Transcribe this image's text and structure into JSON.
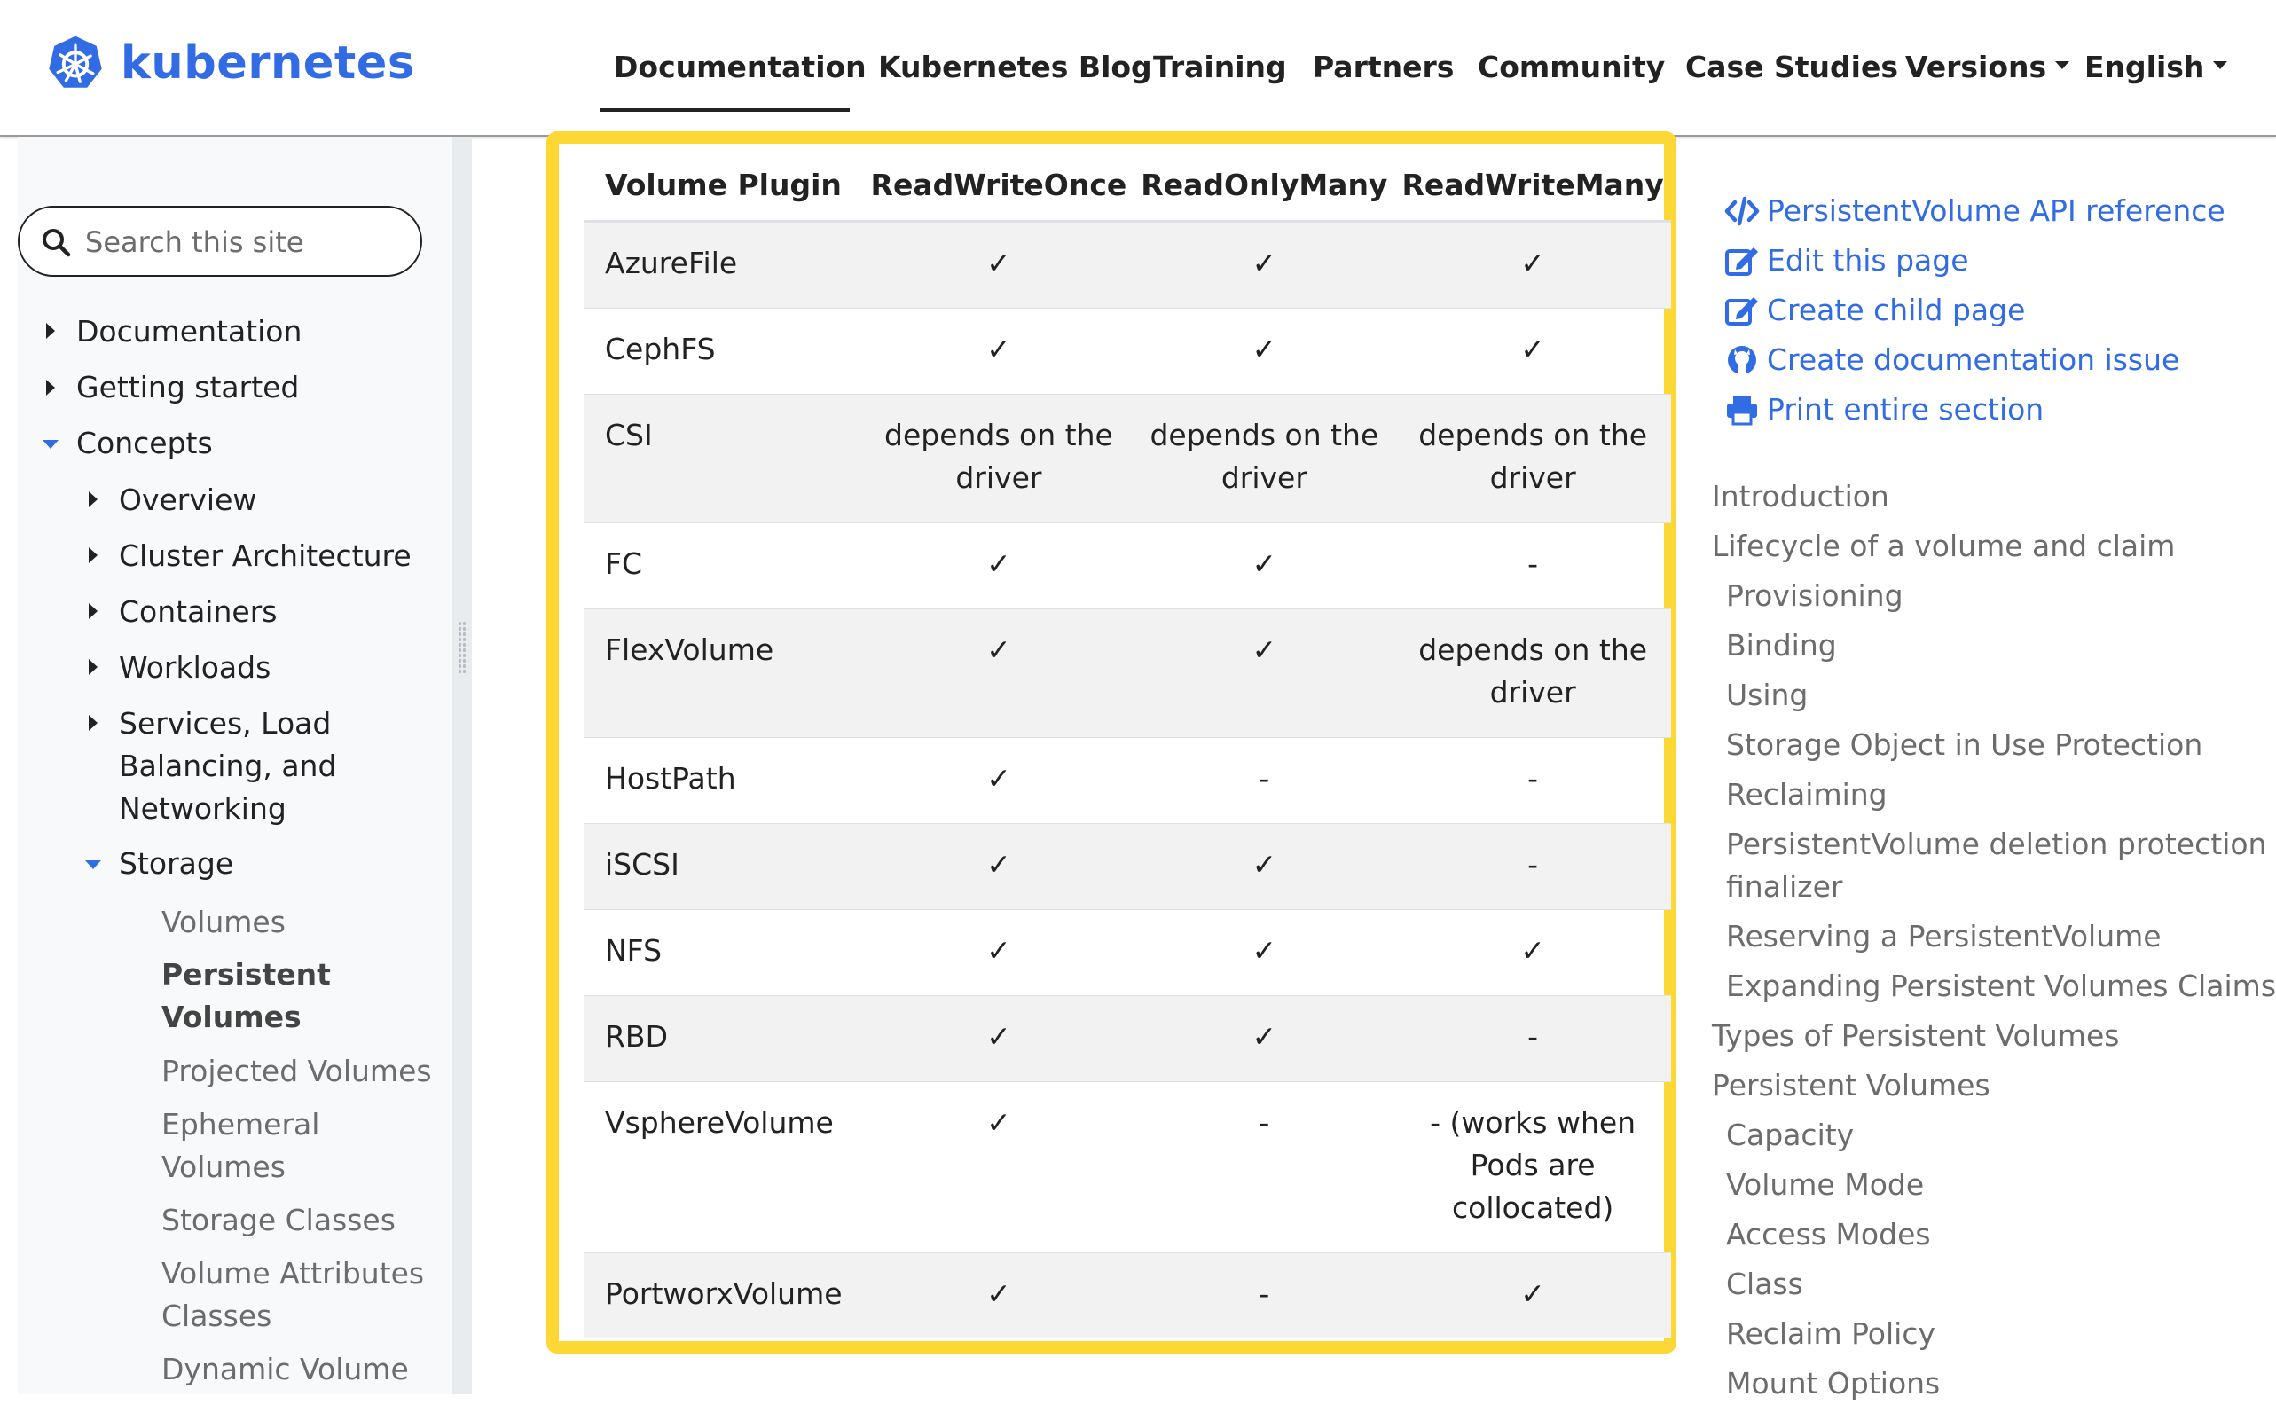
{
  "brand": {
    "name": "kubernetes",
    "color": "#326ce5"
  },
  "nav": {
    "items": [
      "Documentation",
      "Kubernetes Blog",
      "Training",
      "Partners",
      "Community",
      "Case Studies",
      "Versions",
      "English"
    ],
    "active": "Documentation"
  },
  "sidebar": {
    "search_placeholder": "Search this site",
    "top": [
      "Documentation",
      "Getting started",
      "Concepts"
    ],
    "concepts": [
      "Overview",
      "Cluster Architecture",
      "Containers",
      "Workloads"
    ],
    "services": [
      "Services, Load",
      "Balancing, and",
      "Networking"
    ],
    "storage": "Storage",
    "volumes": "Volumes",
    "persistent": [
      "Persistent",
      "Volumes"
    ],
    "projected": "Projected Volumes",
    "ephemeral": [
      "Ephemeral",
      "Volumes"
    ],
    "storage_classes": "Storage Classes",
    "vac": [
      "Volume Attributes",
      "Classes"
    ],
    "dynamic": "Dynamic Volume"
  },
  "table": {
    "headers": [
      "Volume Plugin",
      "ReadWriteOnce",
      "ReadOnlyMany",
      "ReadWriteMany"
    ],
    "rows": [
      [
        "AzureFile",
        "✓",
        "✓",
        "✓"
      ],
      [
        "CephFS",
        "✓",
        "✓",
        "✓"
      ],
      [
        "CSI",
        "depends on the driver",
        "depends on the driver",
        "depends on the driver"
      ],
      [
        "FC",
        "✓",
        "✓",
        "-"
      ],
      [
        "FlexVolume",
        "✓",
        "✓",
        "depends on the driver"
      ],
      [
        "HostPath",
        "✓",
        "-",
        "-"
      ],
      [
        "iSCSI",
        "✓",
        "✓",
        "-"
      ],
      [
        "NFS",
        "✓",
        "✓",
        "✓"
      ],
      [
        "RBD",
        "✓",
        "✓",
        "-"
      ],
      [
        "VsphereVolume",
        "✓",
        "-",
        "- (works when Pods are collocated)"
      ],
      [
        "PortworxVolume",
        "✓",
        "-",
        "✓"
      ]
    ]
  },
  "right": {
    "links": [
      "PersistentVolume API reference",
      "Edit this page",
      "Create child page",
      "Create documentation issue",
      "Print entire section"
    ],
    "toc": [
      "Introduction",
      "Lifecycle of a volume and claim",
      "Provisioning",
      "Binding",
      "Using",
      "Storage Object in Use Protection",
      "Reclaiming",
      "PersistentVolume deletion protection",
      "finalizer",
      "Reserving a PersistentVolume",
      "Expanding Persistent Volumes Claims",
      "Types of Persistent Volumes",
      "Persistent Volumes",
      "Capacity",
      "Volume Mode",
      "Access Modes",
      "Class",
      "Reclaim Policy",
      "Mount Options"
    ]
  },
  "colors": {
    "highlight": "#fdd835",
    "link": "#326ce5",
    "muted": "#6c6c6c"
  }
}
